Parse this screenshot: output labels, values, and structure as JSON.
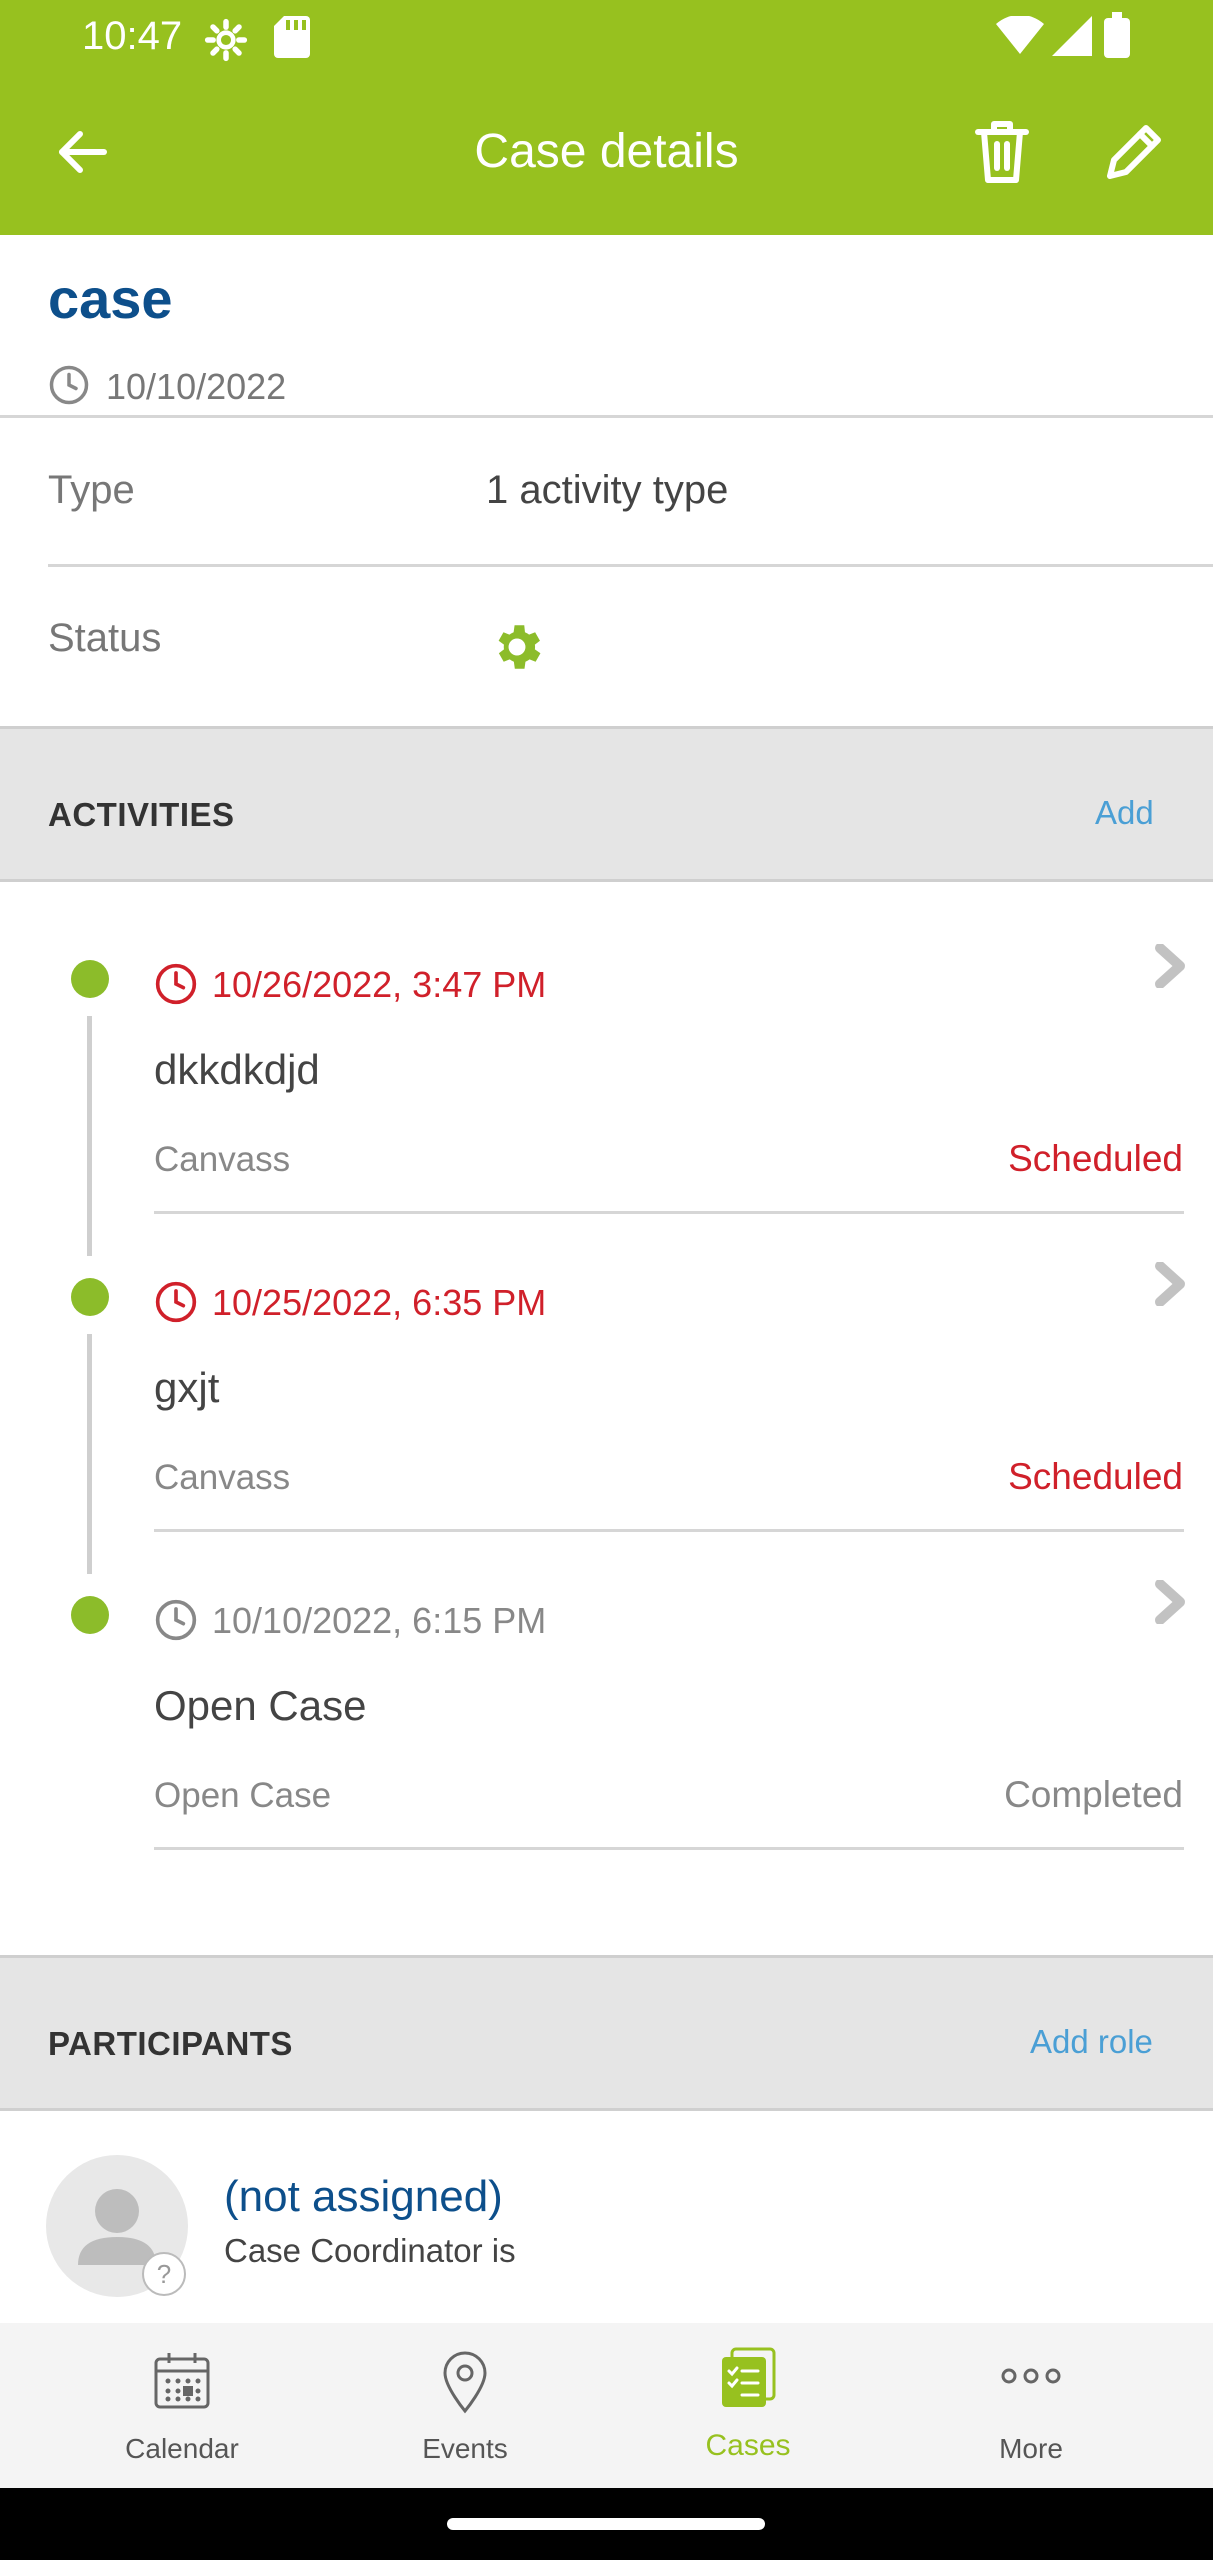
{
  "status_bar": {
    "time": "10:47"
  },
  "app_bar": {
    "title": "Case details"
  },
  "case": {
    "title": "case",
    "date": "10/10/2022"
  },
  "fields": [
    {
      "label": "Type",
      "value": "1 activity type"
    },
    {
      "label": "Status",
      "icon": "gear-icon",
      "icon_color": "#8cbc2a"
    }
  ],
  "activities_section": {
    "heading": "ACTIVITIES",
    "action": "Add"
  },
  "activities": [
    {
      "datetime": "10/26/2022, 3:47 PM",
      "title": "dkkdkdjd",
      "type": "Canvass",
      "status": "Scheduled",
      "color": "#d0202a"
    },
    {
      "datetime": "10/25/2022, 6:35 PM",
      "title": "gxjt",
      "type": "Canvass",
      "status": "Scheduled",
      "color": "#d0202a"
    },
    {
      "datetime": "10/10/2022, 6:15 PM",
      "title": "Open Case",
      "type": "Open Case",
      "status": "Completed",
      "color": "#888888"
    }
  ],
  "participants_section": {
    "heading": "PARTICIPANTS",
    "action": "Add role"
  },
  "participants": [
    {
      "name": "(not assigned)",
      "role": "Case Coordinator is",
      "badge": "?"
    }
  ],
  "bottom_nav": [
    {
      "label": "Calendar",
      "icon": "calendar-icon",
      "active": false
    },
    {
      "label": "Events",
      "icon": "location-pin-icon",
      "active": false
    },
    {
      "label": "Cases",
      "icon": "cases-icon",
      "active": true
    },
    {
      "label": "More",
      "icon": "more-dots-icon",
      "active": false
    }
  ],
  "colors": {
    "brand": "#97c11f",
    "link": "#4a9fd5",
    "title": "#0d4f8b",
    "overdue": "#d0202a"
  }
}
